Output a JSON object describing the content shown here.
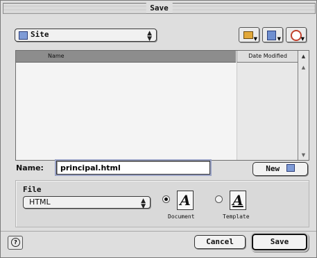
{
  "window": {
    "title": "Save"
  },
  "location": {
    "selected": "Site"
  },
  "toolbar": {
    "icons": [
      "favorites-icon",
      "shortcuts-icon",
      "recent-icon"
    ]
  },
  "file_list": {
    "columns": [
      "Name",
      "Date Modified"
    ],
    "rows": []
  },
  "name_field": {
    "label": "Name:",
    "value": "principal.html"
  },
  "new_button": {
    "label": "New"
  },
  "format": {
    "label": "File",
    "selected": "HTML",
    "options": [
      {
        "label": "Document",
        "selected": true
      },
      {
        "label": "Template",
        "selected": false
      }
    ]
  },
  "actions": {
    "cancel": "Cancel",
    "save": "Save"
  }
}
